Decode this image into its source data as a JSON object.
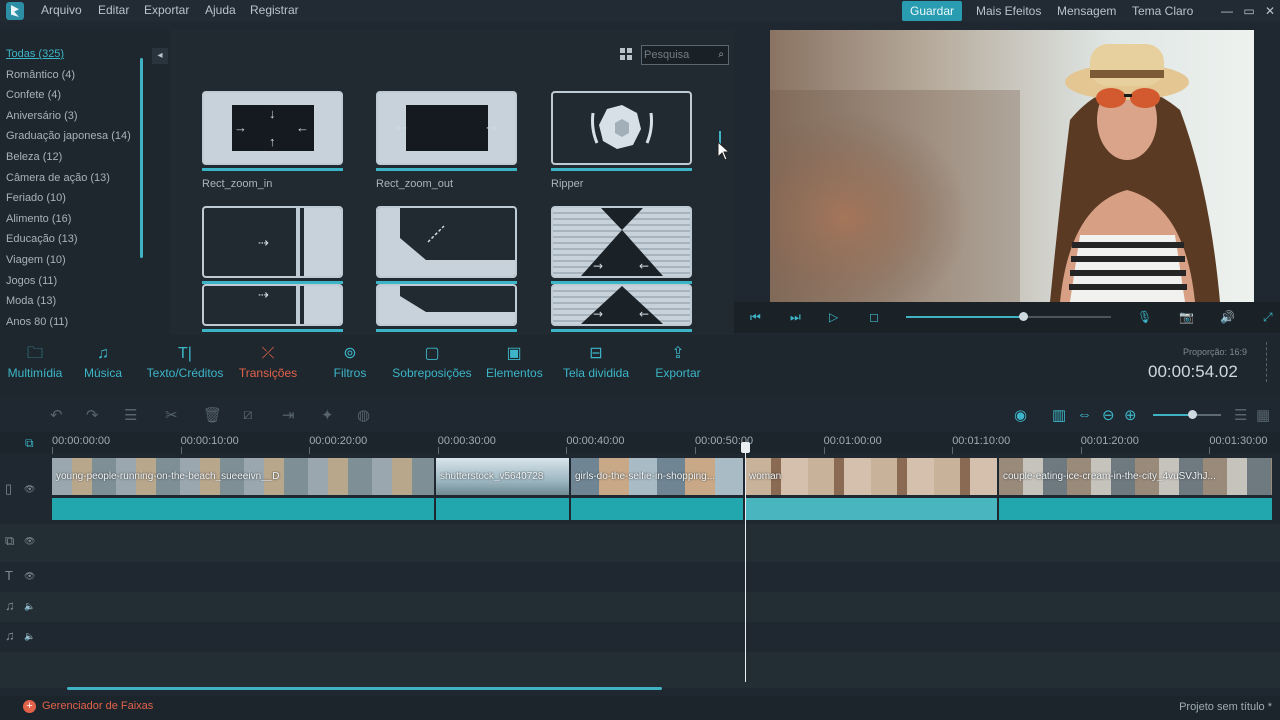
{
  "menu": {
    "items": [
      "Arquivo",
      "Editar",
      "Exportar",
      "Ajuda",
      "Registrar"
    ],
    "right_buttons": [
      "Guardar",
      "Mais Efeitos",
      "Mensagem",
      "Tema Claro"
    ]
  },
  "categories": [
    "Todas (325)",
    "Romântico (4)",
    "Confete (4)",
    "Aniversário (3)",
    "Graduação japonesa (14)",
    "Beleza (12)",
    "Câmera de ação (13)",
    "Feriado (10)",
    "Alimento (16)",
    "Educação (13)",
    "Viagem (10)",
    "Jogos (11)",
    "Moda (13)",
    "Anos 80 (11)"
  ],
  "search": {
    "placeholder": "Pesquisa"
  },
  "transitions": [
    "Rect_zoom_in",
    "Rect_zoom_out",
    "Ripper"
  ],
  "tools": [
    "Multimídia",
    "Música",
    "Texto/Créditos",
    "Transições",
    "Filtros",
    "Sobreposições",
    "Elementos",
    "Tela dividida",
    "Exportar"
  ],
  "active_tool": "Transições",
  "ratio": "Proporção: 16:9",
  "timecode": "00:00:54.02",
  "playback_progress": 0.57,
  "zoom_level": 0.57,
  "ruler_ticks": [
    "00:00:00:00",
    "00:00:10:00",
    "00:00:20:00",
    "00:00:30:00",
    "00:00:40:00",
    "00:00:50:00",
    "00:01:00:00",
    "00:01:10:00",
    "00:01:20:00",
    "00:01:30:00"
  ],
  "clips": [
    "young-people-running-on-the-beach_sueeeivn__D",
    "shutterstock_v5640728",
    "girls-do-the-selfie-in-shopping...",
    "woman",
    "couple-eating-ice-cream-in-the-city_4vuSVJhJ..."
  ],
  "status": {
    "track_manager": "Gerenciador de Faixas",
    "project": "Projeto sem título *"
  },
  "colors": {
    "accent": "#3cb6c8",
    "active": "#e2624a",
    "clip_bar": "#21a7ad"
  }
}
